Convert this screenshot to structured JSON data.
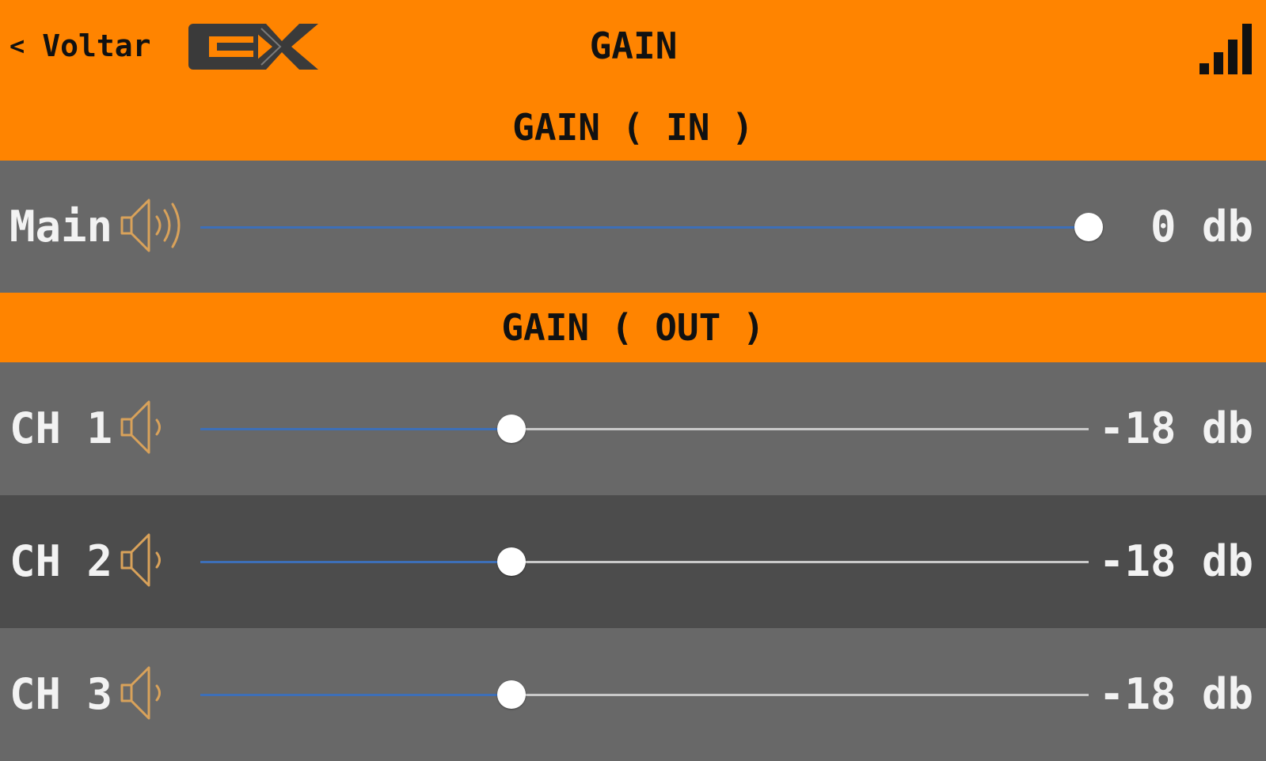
{
  "header": {
    "back_label": "Voltar",
    "logo_text": "EX",
    "title": "GAIN",
    "signal_icon": "signal-bars-icon"
  },
  "sections": {
    "in_title": "GAIN ( IN )",
    "out_title": "GAIN ( OUT )"
  },
  "colors": {
    "accent": "#ff8400",
    "row_bg": "#686868",
    "row_bg_alt": "#4c4c4c",
    "slider_fill": "#3d6fb8",
    "speaker_icon": "#d9a25a"
  },
  "channels": [
    {
      "label": "Main",
      "value": "0 db",
      "level_percent": 100,
      "icon": "speaker-loud-icon"
    },
    {
      "label": "CH 1",
      "value": "-18 db",
      "level_percent": 35,
      "icon": "speaker-icon"
    },
    {
      "label": "CH 2",
      "value": "-18 db",
      "level_percent": 35,
      "icon": "speaker-icon"
    },
    {
      "label": "CH 3",
      "value": "-18 db",
      "level_percent": 35,
      "icon": "speaker-icon"
    }
  ]
}
